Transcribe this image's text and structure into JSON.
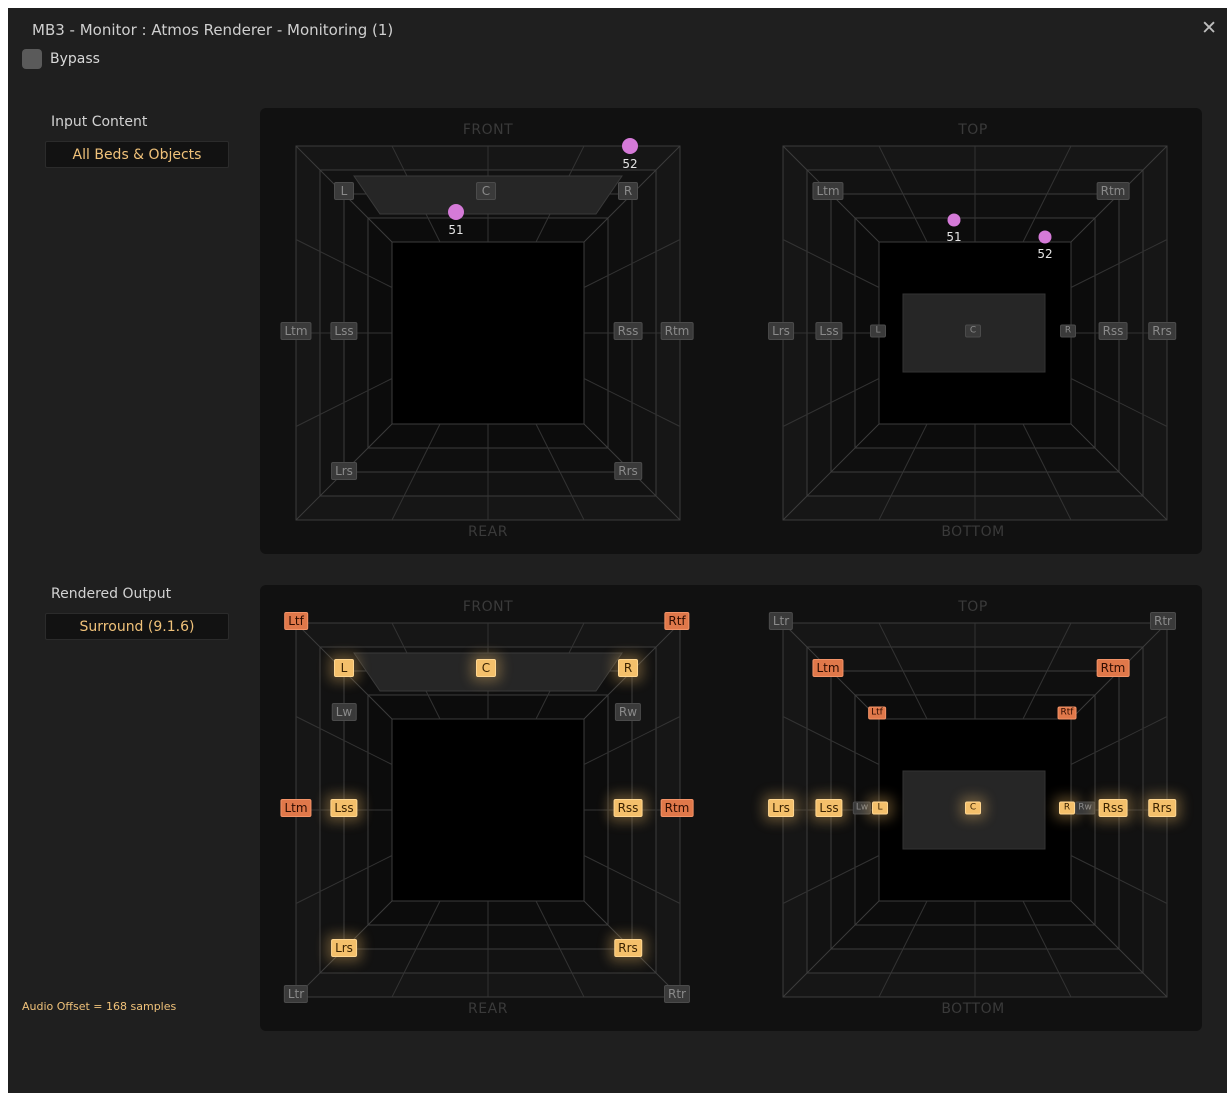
{
  "window": {
    "title": "MB3 - Monitor : Atmos Renderer - Monitoring (1)",
    "close_symbol": "✕"
  },
  "bypass": {
    "label": "Bypass",
    "checked": false
  },
  "input": {
    "label": "Input Content",
    "value": "All Beds & Objects"
  },
  "output": {
    "label": "Rendered Output",
    "value": "Surround (9.1.6)"
  },
  "views": {
    "front": "FRONT",
    "rear": "REAR",
    "top": "TOP",
    "bottom": "BOTTOM"
  },
  "input_front": {
    "speakers": {
      "L": "L",
      "C": "C",
      "R": "R",
      "Ltm": "Ltm",
      "Lss": "Lss",
      "Rss": "Rss",
      "Rtm": "Rtm",
      "Lrs": "Lrs",
      "Rrs": "Rrs"
    },
    "objects": [
      {
        "id": "51",
        "label": "51"
      },
      {
        "id": "52",
        "label": "52"
      }
    ]
  },
  "input_top": {
    "speakers": {
      "Ltm": "Ltm",
      "Rtm": "Rtm",
      "Lrs": "Lrs",
      "Lss": "Lss",
      "L": "L",
      "C": "C",
      "R": "R",
      "Rss": "Rss",
      "Rrs": "Rrs"
    },
    "objects": [
      {
        "id": "51",
        "label": "51"
      },
      {
        "id": "52",
        "label": "52"
      }
    ]
  },
  "output_front": {
    "speakers": {
      "Ltf": "Ltf",
      "Rtf": "Rtf",
      "L": "L",
      "C": "C",
      "R": "R",
      "Lw": "Lw",
      "Rw": "Rw",
      "Ltm": "Ltm",
      "Lss": "Lss",
      "Rss": "Rss",
      "Rtm": "Rtm",
      "Lrs": "Lrs",
      "Rrs": "Rrs",
      "Ltr": "Ltr",
      "Rtr": "Rtr"
    }
  },
  "output_top": {
    "speakers": {
      "Ltr": "Ltr",
      "Rtr": "Rtr",
      "Ltm": "Ltm",
      "Rtm": "Rtm",
      "Ltf": "Ltf",
      "Rtf": "Rtf",
      "Lrs": "Lrs",
      "Lss": "Lss",
      "Lw": "Lw",
      "L": "L",
      "C": "C",
      "R": "R",
      "Rw": "Rw",
      "Rss": "Rss",
      "Rrs": "Rrs"
    }
  },
  "status": {
    "audio_offset": "Audio Offset = 168 samples"
  },
  "colors": {
    "active": "#f4c06b",
    "height_active": "#e0784a",
    "inactive": "#3a3a3a",
    "object": "#d57ad8",
    "accent_text": "#f0c27a"
  }
}
